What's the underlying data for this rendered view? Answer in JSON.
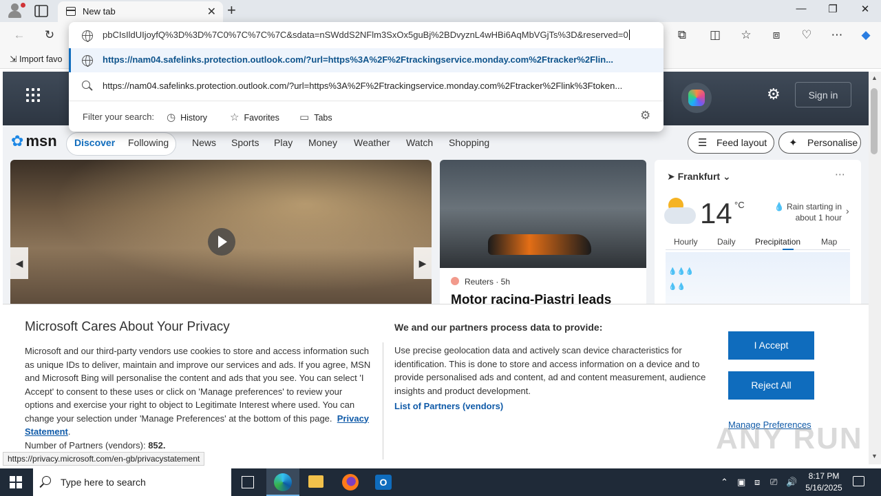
{
  "browser": {
    "tab_title": "New tab",
    "address_input": "pbCIsIldUIjoyfQ%3D%3D%7C0%7C%7C%7C&sdata=nSWddS2NFlm3SxOx5guBj%2BDvyznL4wHBi6AqMbVGjTs%3D&reserved=0",
    "suggestion_url": "https://nam04.safelinks.protection.outlook.com/?url=https%3A%2F%2Ftrackingservice.monday.com%2Ftracker%2Flin...",
    "suggestion_search": "https://nam04.safelinks.protection.outlook.com/?url=https%3A%2F%2Ftrackingservice.monday.com%2Ftracker%2Flink%3Ftoken...",
    "filter_label": "Filter your search:",
    "filters": [
      "History",
      "Favorites",
      "Tabs"
    ],
    "favorites_bar_label": "Import favo",
    "status_url": "https://privacy.microsoft.com/en-gb/privacystatement"
  },
  "msn": {
    "sign_in": "Sign in",
    "logo": "msn",
    "nav": [
      "Discover",
      "Following",
      "News",
      "Sports",
      "Play",
      "Money",
      "Weather",
      "Watch",
      "Shopping"
    ],
    "feed_layout": "Feed layout",
    "personalise": "Personalise",
    "news_source": "Reuters · 5h",
    "news_headline": "Motor racing-Piastri leads",
    "weather": {
      "city": "Frankfurt",
      "temp": "14",
      "unit": "°C",
      "desc": "Rain starting in about 1 hour",
      "tabs": [
        "Hourly",
        "Daily",
        "Precipitation",
        "Map"
      ]
    }
  },
  "privacy": {
    "title": "Microsoft Cares About Your Privacy",
    "body": "Microsoft and our third-party vendors use cookies to store and access information such as unique IDs to deliver, maintain and improve our services and ads. If you agree, MSN and Microsoft Bing will personalise the content and ads that you see. You can select 'I Accept' to consent to these uses or click on 'Manage preferences' to review your options and exercise your right to object to Legitimate Interest where used.  You can change your selection under 'Manage Preferences' at the bottom of this page.",
    "privacy_link": "Privacy Statement",
    "partners_label": "Number of Partners (vendors):",
    "partners_count": "852.",
    "process_title": "We and our partners process data to provide:",
    "process_body": "Use precise geolocation data and actively scan device characteristics for identification. This is done to store and access information on a device and to provide personalised ads and content, ad and content measurement, audience insights and product development.",
    "partners_link": "List of Partners (vendors)",
    "accept": "I Accept",
    "reject": "Reject All",
    "manage": "Manage Preferences"
  },
  "watermark": "ANY RUN",
  "taskbar": {
    "search_placeholder": "Type here to search",
    "time": "8:17 PM",
    "date": "5/16/2025"
  }
}
